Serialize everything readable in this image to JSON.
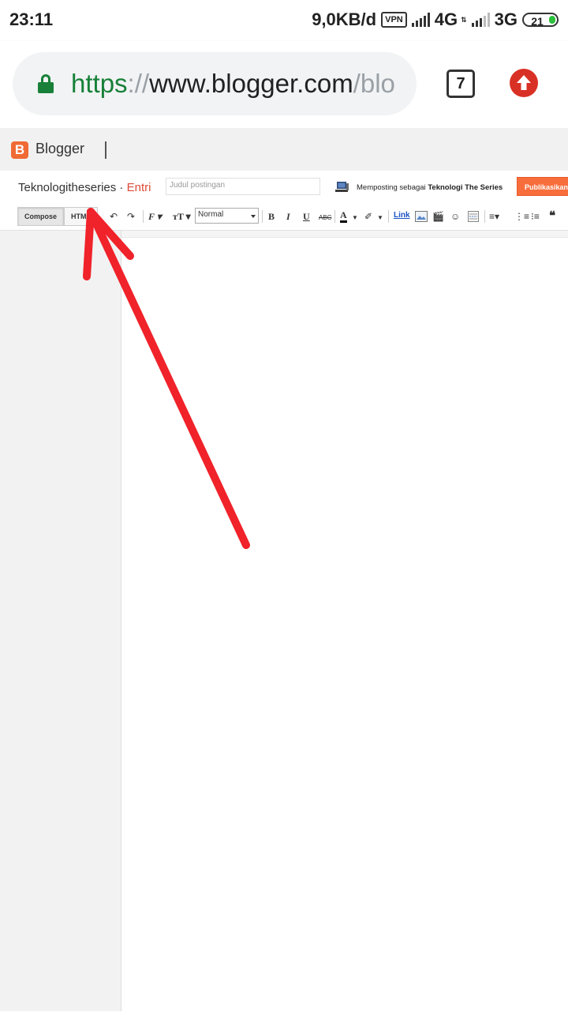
{
  "status_bar": {
    "time": "23:11",
    "speed": "9,0KB/d",
    "vpn": "VPN",
    "network1": "4G",
    "network2": "3G",
    "battery": "21"
  },
  "browser": {
    "url_scheme": "https",
    "url_sep": "://",
    "url_host": "www.blogger.com",
    "url_path": "/blo",
    "tab_count": "7"
  },
  "blogger": {
    "logo_letter": "B",
    "app_name": "Blogger"
  },
  "post": {
    "blog_name": "Teknologitheseries",
    "separator": " · ",
    "section": "Entri",
    "title_placeholder": "Judul postingan",
    "posting_as_prefix": "Memposting sebagai ",
    "posting_as_name": "Teknologi The Series",
    "publish_label": "Publikasikan"
  },
  "toolbar": {
    "compose_label": "Compose",
    "html_label": "HTML",
    "format_value": "Normal",
    "link_label": "Link",
    "strike_label": "ABC"
  },
  "colors": {
    "blogger_orange": "#f06a35",
    "publish_orange": "#f76e3c",
    "annotation_red": "#f0222a",
    "secure_green": "#188038"
  }
}
